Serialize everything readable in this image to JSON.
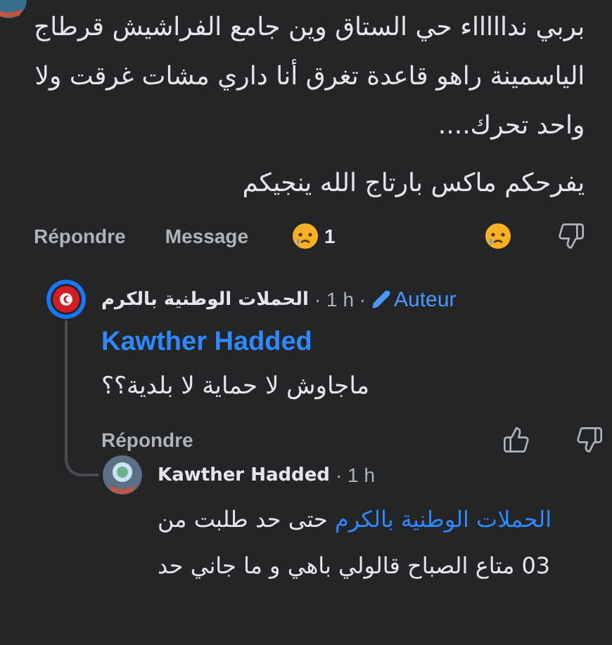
{
  "comment": {
    "paragraphs": [
      [
        [
          {
            "kind": "text",
            "text": "بربي نداااااء حي الستاق وين جامع الفراشيش قرطاج"
          }
        ],
        [
          {
            "kind": "text",
            "text": "الياسمينة راهو قاعدة تغرق أنا داري مشات غرقت ولا"
          }
        ],
        [
          {
            "kind": "text",
            "text": "واحد تحرك...."
          }
        ]
      ],
      [
        [
          {
            "kind": "text",
            "text": "يفرحكم ماكس بارتاج الله ينجيكم"
          }
        ]
      ]
    ],
    "actions": {
      "reply": "Répondre",
      "message": "Message",
      "reaction_count": "1"
    }
  },
  "replies": [
    {
      "author": "الحملات الوطنية بالكرم",
      "time": "· 1 h ·",
      "badge": "Auteur",
      "lines": [
        [
          {
            "kind": "mention",
            "text": "Kawther Hadded"
          }
        ],
        [
          {
            "kind": "text",
            "text": "ماجاوش لا حماية لا بلدية؟؟"
          }
        ]
      ],
      "actions": {
        "reply": "Répondre"
      },
      "replies": [
        {
          "author": "Kawther Hadded",
          "time": "· 1 h",
          "lines": [
            [
              {
                "kind": "mention",
                "text": "الحملات الوطنية بالكرم"
              },
              {
                "kind": "text",
                "text": " حتى حد طلبت من"
              }
            ],
            [
              {
                "kind": "text",
                "text": "03 متاع الصباح قالولي باهي و ما جاني حد"
              }
            ]
          ]
        }
      ]
    }
  ]
}
